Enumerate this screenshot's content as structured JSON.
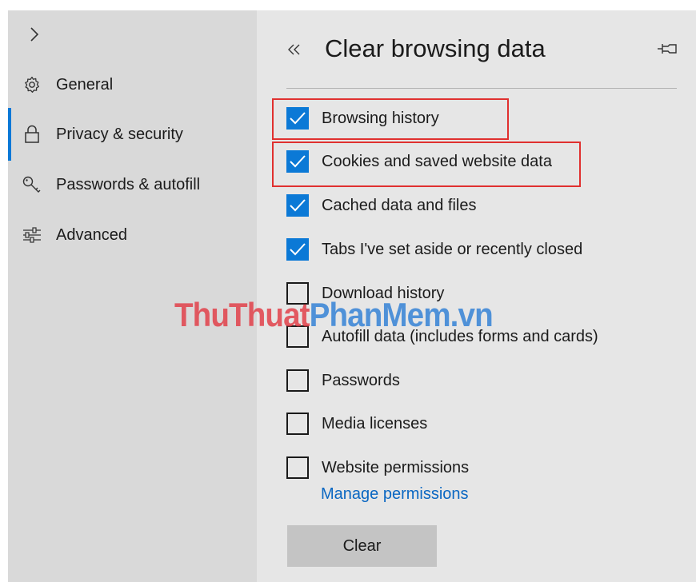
{
  "sidebar": {
    "items": [
      {
        "label": "General",
        "icon": "gear-icon"
      },
      {
        "label": "Privacy & security",
        "icon": "lock-icon",
        "active": true
      },
      {
        "label": "Passwords & autofill",
        "icon": "key-icon"
      },
      {
        "label": "Advanced",
        "icon": "sliders-icon"
      }
    ]
  },
  "panel": {
    "title": "Clear browsing data",
    "options": [
      {
        "label": "Browsing history",
        "checked": true
      },
      {
        "label": "Cookies and saved website data",
        "checked": true
      },
      {
        "label": "Cached data and files",
        "checked": true
      },
      {
        "label": "Tabs I've set aside or recently closed",
        "checked": true
      },
      {
        "label": "Download history",
        "checked": false
      },
      {
        "label": "Autofill data (includes forms and cards)",
        "checked": false
      },
      {
        "label": "Passwords",
        "checked": false
      },
      {
        "label": "Media licenses",
        "checked": false
      },
      {
        "label": "Website permissions",
        "checked": false
      }
    ],
    "manage_link": "Manage permissions",
    "clear_button": "Clear"
  },
  "watermark": {
    "part1": "ThuThuat",
    "part2": "PhanMem.vn"
  },
  "colors": {
    "accent": "#0b79d6",
    "highlight": "#e0302f",
    "link": "#0a67c2",
    "watermark_red": "#e23b45",
    "watermark_blue": "#2f7fd6"
  }
}
